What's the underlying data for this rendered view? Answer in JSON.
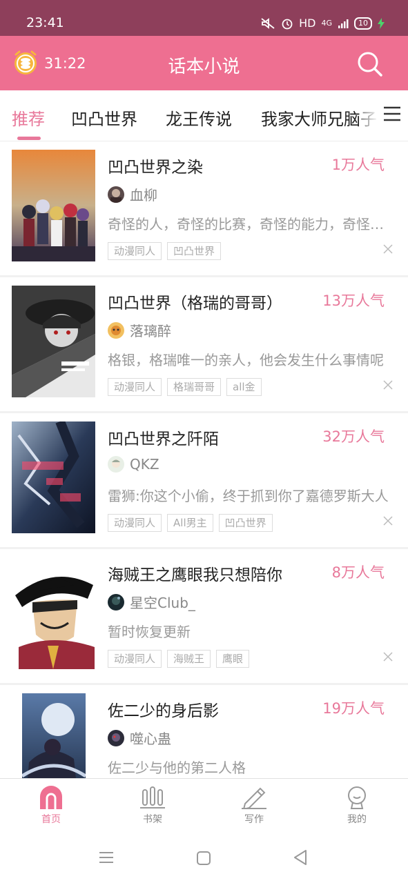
{
  "status_bar": {
    "time": "23:41",
    "network": "HD",
    "signal": "4G",
    "battery": "10"
  },
  "header": {
    "timer": "31:22",
    "title": "话本小说",
    "search_icon": "search-icon",
    "timer_icon": "alarm-coin-icon"
  },
  "tabs": [
    {
      "label": "推荐",
      "active": true
    },
    {
      "label": "凹凸世界",
      "active": false
    },
    {
      "label": "龙王传说",
      "active": false
    },
    {
      "label": "我家大师兄脑子",
      "active": false
    }
  ],
  "books": [
    {
      "title": "凹凸世界之染",
      "popularity": "1万人气",
      "author": "血柳",
      "description": "奇怪的人，奇怪的比赛，奇怪的能力，奇怪的世界",
      "tags": [
        "动漫同人",
        "凹凸世界"
      ]
    },
    {
      "title": "凹凸世界（格瑞的哥哥）",
      "popularity": "13万人气",
      "author": "落璃醉",
      "description": "格银，格瑞唯一的亲人，他会发生什么事情呢",
      "tags": [
        "动漫同人",
        "格瑞哥哥",
        "all金"
      ]
    },
    {
      "title": "凹凸世界之阡陌",
      "popularity": "32万人气",
      "author": "QKZ",
      "description": "雷狮:你这个小偷，终于抓到你了嘉德罗斯大人",
      "tags": [
        "动漫同人",
        "All男主",
        "凹凸世界"
      ]
    },
    {
      "title": "海贼王之鹰眼我只想陪你",
      "popularity": "8万人气",
      "author": "星空Club_",
      "description": "暂时恢复更新",
      "tags": [
        "动漫同人",
        "海贼王",
        "鹰眼"
      ]
    },
    {
      "title": "佐二少的身后影",
      "popularity": "19万人气",
      "author": "噬心蛊",
      "description": "佐二少与他的第二人格",
      "tags": []
    }
  ],
  "bottom_nav": [
    {
      "label": "首页",
      "icon": "home-icon",
      "active": true
    },
    {
      "label": "书架",
      "icon": "bookshelf-icon",
      "active": false
    },
    {
      "label": "写作",
      "icon": "pen-icon",
      "active": false
    },
    {
      "label": "我的",
      "icon": "profile-icon",
      "active": false
    }
  ],
  "colors": {
    "accent": "#ee6f91",
    "status_bar": "#8e3f5b",
    "popularity": "#e8789a"
  }
}
